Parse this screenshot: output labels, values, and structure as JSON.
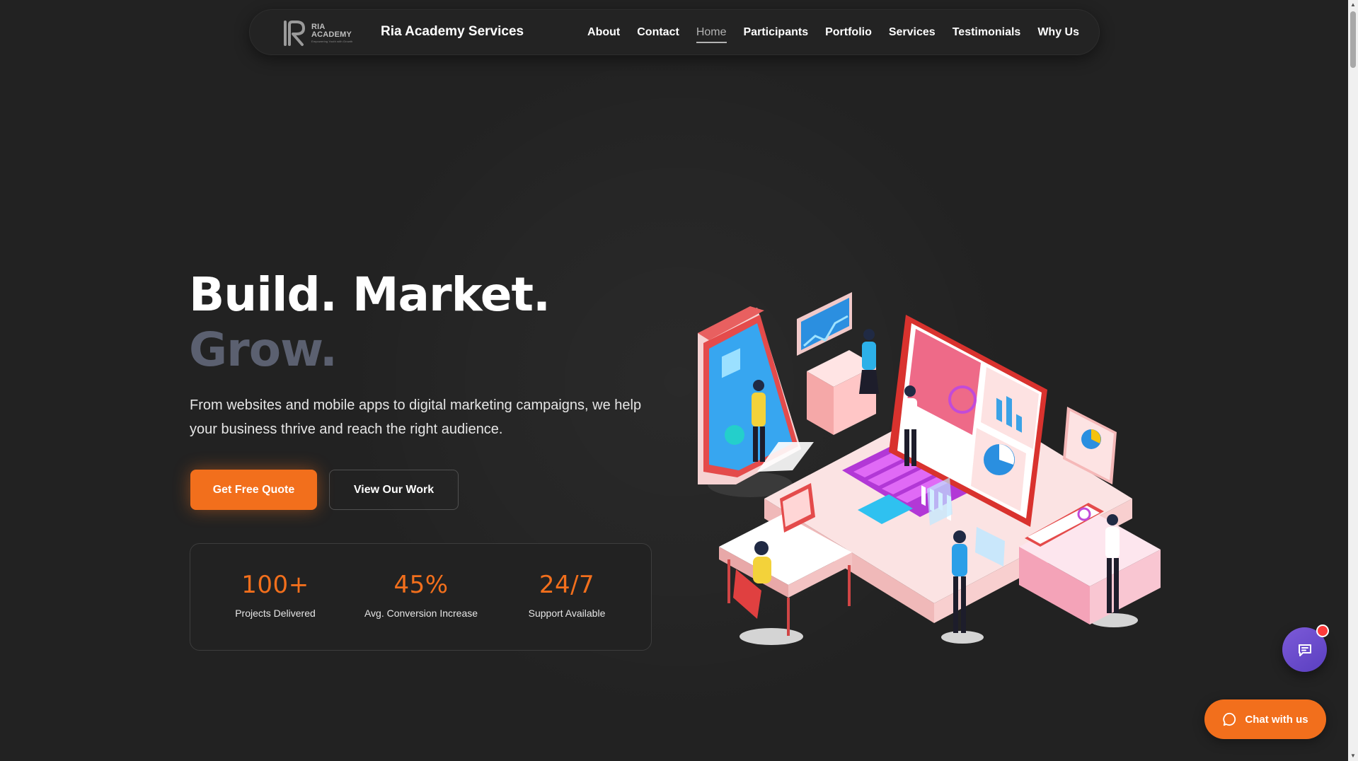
{
  "nav": {
    "logo": {
      "line1": "RIA",
      "line2": "ACADEMY",
      "tagline": "Empowering Youth with Growth"
    },
    "brand": "Ria Academy Services",
    "links": [
      {
        "label": "About"
      },
      {
        "label": "Contact"
      },
      {
        "label": "Home",
        "active": true
      },
      {
        "label": "Participants"
      },
      {
        "label": "Portfolio"
      },
      {
        "label": "Services"
      },
      {
        "label": "Testimonials"
      },
      {
        "label": "Why Us"
      }
    ]
  },
  "hero": {
    "title_line1": "Build. Market.",
    "title_line2": "Grow.",
    "description": "From websites and mobile apps to digital marketing campaigns, we help your business thrive and reach the right audience.",
    "primary_button": "Get Free Quote",
    "secondary_button": "View Our Work"
  },
  "stats": [
    {
      "value": "100+",
      "label": "Projects Delivered"
    },
    {
      "value": "45%",
      "label": "Avg. Conversion Increase"
    },
    {
      "value": "24/7",
      "label": "Support Available"
    }
  ],
  "chat": {
    "pill_label": "Chat with us"
  },
  "colors": {
    "background": "#222222",
    "accent": "#f26f1c",
    "muted_title": "#5b6070",
    "chat_bubble": "#6a4bcc"
  },
  "icons": {
    "chat_bubble": "message-square-icon",
    "chat_pill": "message-circle-icon"
  }
}
